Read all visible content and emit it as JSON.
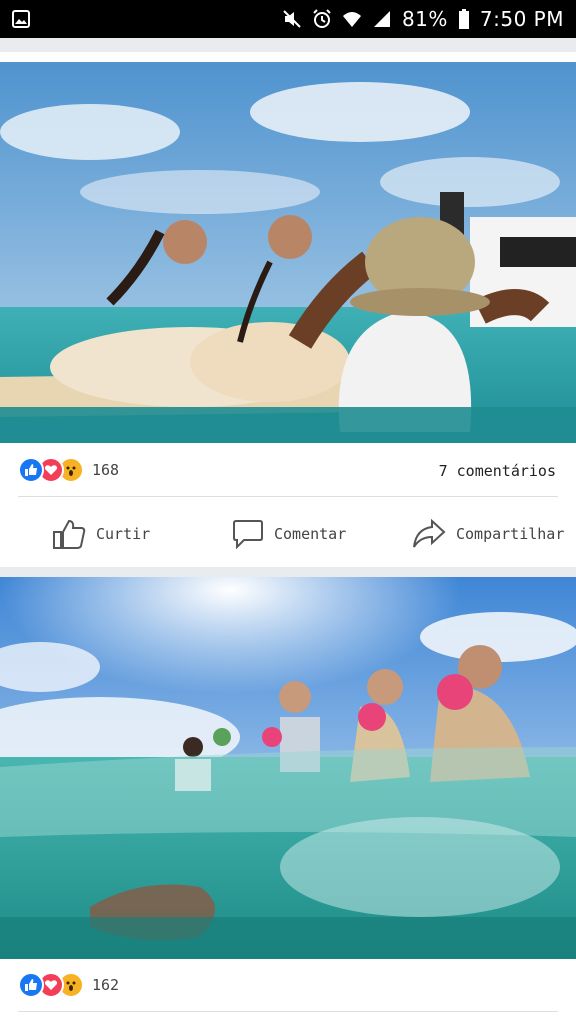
{
  "status_bar": {
    "battery": "81%",
    "time": "7:50 PM",
    "icons": [
      "gallery-icon",
      "mute-icon",
      "alarm-icon",
      "wifi-icon",
      "signal-icon",
      "battery-icon"
    ]
  },
  "posts": [
    {
      "photo": "photo-girls-on-boat",
      "reaction_count": "168",
      "comments_label": "7 comentários",
      "actions": {
        "like": "Curtir",
        "comment": "Comentar",
        "share": "Compartilhar"
      }
    },
    {
      "photo": "photo-bridesmaids-in-water",
      "reaction_count": "162"
    }
  ],
  "colors": {
    "like": "#1877f2",
    "love": "#f33e58",
    "wow": "#f7b125",
    "feed_bg": "#e9ebee"
  }
}
